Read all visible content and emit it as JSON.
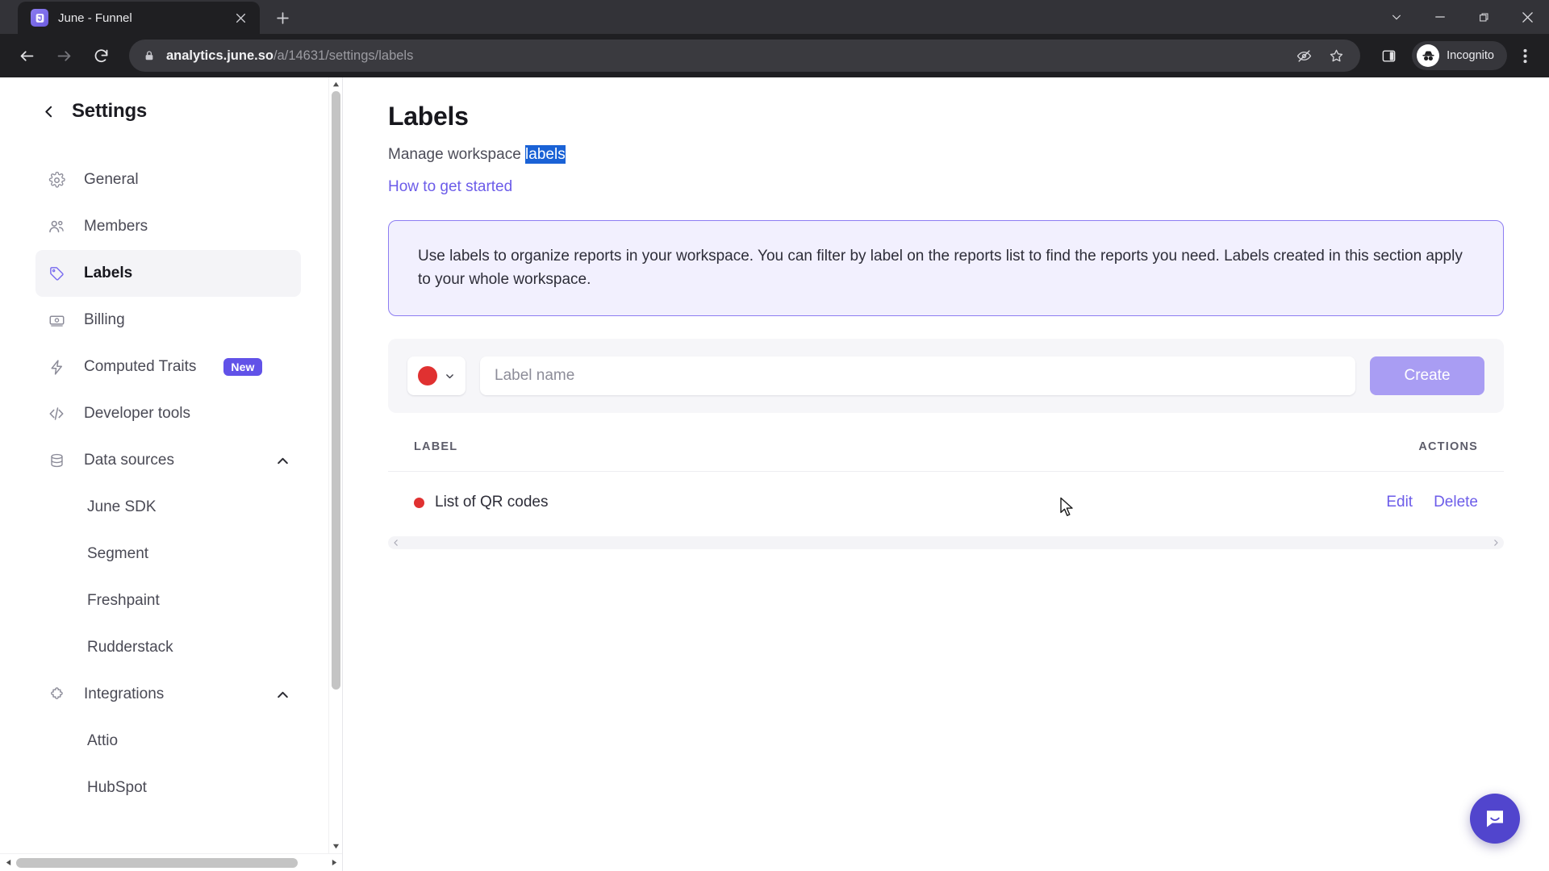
{
  "browser": {
    "tab": {
      "title": "June - Funnel",
      "favicon_icon": "june-logo-icon",
      "close_icon": "close-icon"
    },
    "new_tab_icon": "plus-icon",
    "window_controls": [
      {
        "name": "tab-search",
        "icon": "chevron-down-icon"
      },
      {
        "name": "minimize",
        "icon": "minimize-icon"
      },
      {
        "name": "restore",
        "icon": "restore-icon"
      },
      {
        "name": "close",
        "icon": "close-icon"
      }
    ],
    "nav": {
      "back_icon": "arrow-left-icon",
      "forward_icon": "arrow-right-icon",
      "reload_icon": "reload-icon"
    },
    "omnibox": {
      "lock_icon": "lock-icon",
      "url_domain": "analytics.june.so",
      "url_path": "/a/14631/settings/labels",
      "tracking_icon": "eye-off-icon",
      "bookmark_icon": "star-icon"
    },
    "side_panel_icon": "side-panel-icon",
    "profile": {
      "label": "Incognito",
      "icon": "incognito-icon"
    },
    "menu_icon": "kebab-menu-icon"
  },
  "sidebar": {
    "back_icon": "chevron-left-icon",
    "title": "Settings",
    "items": [
      {
        "label": "General",
        "icon": "gear-icon",
        "type": "item",
        "active": false
      },
      {
        "label": "Members",
        "icon": "users-icon",
        "type": "item",
        "active": false
      },
      {
        "label": "Labels",
        "icon": "tag-icon",
        "type": "item",
        "active": true
      },
      {
        "label": "Billing",
        "icon": "billing-card-icon",
        "type": "item",
        "active": false
      },
      {
        "label": "Computed Traits",
        "icon": "lightning-icon",
        "type": "item",
        "active": false,
        "badge": "New"
      },
      {
        "label": "Developer tools",
        "icon": "code-icon",
        "type": "item",
        "active": false
      },
      {
        "label": "Data sources",
        "icon": "database-icon",
        "type": "group",
        "chevron": "chevron-up-icon"
      },
      {
        "label": "June SDK",
        "type": "sub"
      },
      {
        "label": "Segment",
        "type": "sub"
      },
      {
        "label": "Freshpaint",
        "type": "sub"
      },
      {
        "label": "Rudderstack",
        "type": "sub"
      },
      {
        "label": "Integrations",
        "icon": "puzzle-icon",
        "type": "group",
        "chevron": "chevron-up-icon"
      },
      {
        "label": "Attio",
        "type": "sub"
      },
      {
        "label": "HubSpot",
        "type": "sub"
      }
    ]
  },
  "main": {
    "title": "Labels",
    "subtitle_prefix": "Manage workspace ",
    "subtitle_selected": "labels",
    "how_to_link": "How to get started",
    "info_banner": "Use labels to organize reports in your workspace. You can filter by label on the reports list to find the reports you need. Labels created in this section apply to your whole workspace.",
    "create": {
      "swatch_color": "#e03131",
      "swatch_chevron_icon": "chevron-down-icon",
      "input_placeholder": "Label name",
      "input_value": "",
      "button_label": "Create"
    },
    "table": {
      "columns": [
        "LABEL",
        "ACTIONS"
      ],
      "rows": [
        {
          "label": "List of QR codes",
          "color": "#e03131",
          "actions": [
            "Edit",
            "Delete"
          ]
        }
      ],
      "scroll_left_icon": "chevron-left-icon",
      "scroll_right_icon": "chevron-right-icon"
    },
    "intercom_icon": "intercom-messenger-icon"
  },
  "colors": {
    "accent": "#6c5ce9",
    "banner_border": "#8d7df2",
    "banner_bg": "#f2f0fe",
    "selection": "#1a62d6",
    "intercom": "#5145cd"
  }
}
